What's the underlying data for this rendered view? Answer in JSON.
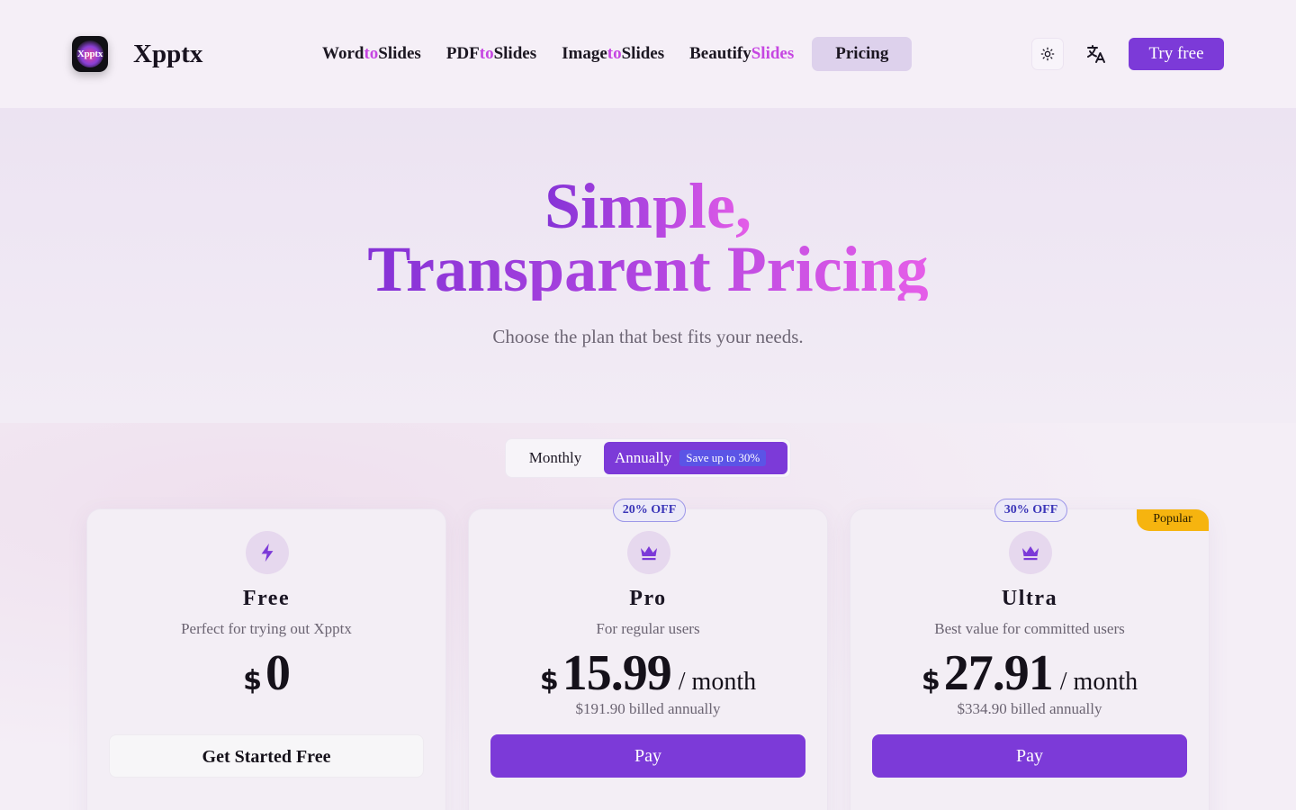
{
  "header": {
    "logo_text": "Xpptx",
    "brand": "Xpptx",
    "nav": [
      {
        "pre": "Word",
        "to": "to",
        "post": "Slides"
      },
      {
        "pre": "PDF",
        "to": "to",
        "post": "Slides"
      },
      {
        "pre": "Image",
        "to": "to",
        "post": "Slides"
      }
    ],
    "beautify": {
      "pre": "Beautify",
      "accent": "Slides"
    },
    "pricing_label": "Pricing",
    "try_free": "Try free"
  },
  "hero": {
    "title_line1": "Simple,",
    "title_line2": "Transparent Pricing",
    "subtitle": "Choose the plan that best fits your needs."
  },
  "billing_toggle": {
    "monthly": "Monthly",
    "annually": "Annually",
    "save_badge": "Save up to 30%",
    "selected": "Annually"
  },
  "plans": [
    {
      "name": "Free",
      "description": "Perfect for trying out Xpptx",
      "currency": "$",
      "price": "0",
      "per": "",
      "billed": "",
      "button": "Get Started Free",
      "icon": "lightning-icon"
    },
    {
      "name": "Pro",
      "description": "For regular users",
      "currency": "$",
      "price": "15.99",
      "per": "/ month",
      "billed": "$191.90 billed annually",
      "button": "Pay",
      "discount": "20% OFF",
      "icon": "crown-icon"
    },
    {
      "name": "Ultra",
      "description": "Best value for committed users",
      "currency": "$",
      "price": "27.91",
      "per": "/ month",
      "billed": "$334.90 billed annually",
      "button": "Pay",
      "discount": "30% OFF",
      "ribbon": "Popular",
      "icon": "crown-icon"
    }
  ],
  "colors": {
    "primary": "#7c3ad8",
    "accent_pink": "#c646e2",
    "popular": "#f6b40f",
    "discount_border": "#9d97e8"
  }
}
